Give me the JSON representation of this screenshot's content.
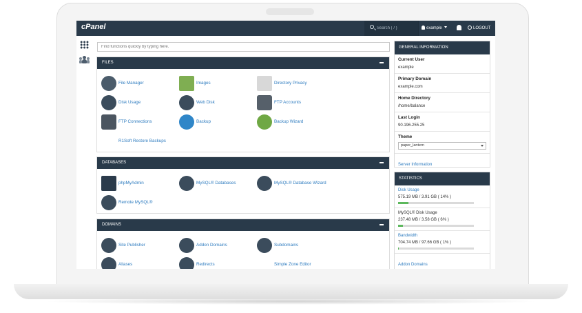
{
  "app": {
    "logo": "cPanel"
  },
  "topbar": {
    "search_placeholder": "Search ( / )",
    "username": "example",
    "logout_label": "LOGOUT"
  },
  "find": {
    "placeholder": "Find functions quickly by typing here."
  },
  "files": {
    "title": "FILES",
    "items": [
      "File Manager",
      "Images",
      "Directory Privacy",
      "Disk Usage",
      "Web Disk",
      "FTP Accounts",
      "FTP Connections",
      "Backup",
      "Backup Wizard",
      "R1Soft Restore Backups"
    ]
  },
  "databases": {
    "title": "DATABASES",
    "items": [
      "phpMyAdmin",
      "MySQL® Databases",
      "MySQL® Database Wizard",
      "Remote MySQL®"
    ]
  },
  "domains": {
    "title": "DOMAINS",
    "items": [
      "Site Publisher",
      "Addon Domains",
      "Subdomains",
      "Aliases",
      "Redirects",
      "Simple Zone Editor"
    ]
  },
  "general_info": {
    "title": "GENERAL INFORMATION",
    "current_user_label": "Current User",
    "current_user": "example",
    "primary_domain_label": "Primary Domain",
    "primary_domain": "example.com",
    "home_directory_label": "Home Directory",
    "home_directory": "/home/balance",
    "last_login_label": "Last Login",
    "last_login": "90.196.255.25",
    "theme_label": "Theme",
    "theme_value": "paper_lantern",
    "server_info_link": "Server Information"
  },
  "statistics": {
    "title": "STATISTICS",
    "items": [
      {
        "label": "Disk Usage",
        "value": "575.19 MB / 3.91 GB ( 14% )",
        "percent": 14
      },
      {
        "label": "MySQL® Disk Usage",
        "value": "237.48 MB / 3.58 GB ( 6% )",
        "percent": 6
      },
      {
        "label": "Bandwidth",
        "value": "704.74 MB / 97.66 GB ( 1% )",
        "percent": 1
      },
      {
        "label": "Addon Domains"
      }
    ]
  },
  "colors": {
    "topbar": "#293a4a",
    "link": "#2d7bbf",
    "progress": "#5cb85c"
  }
}
